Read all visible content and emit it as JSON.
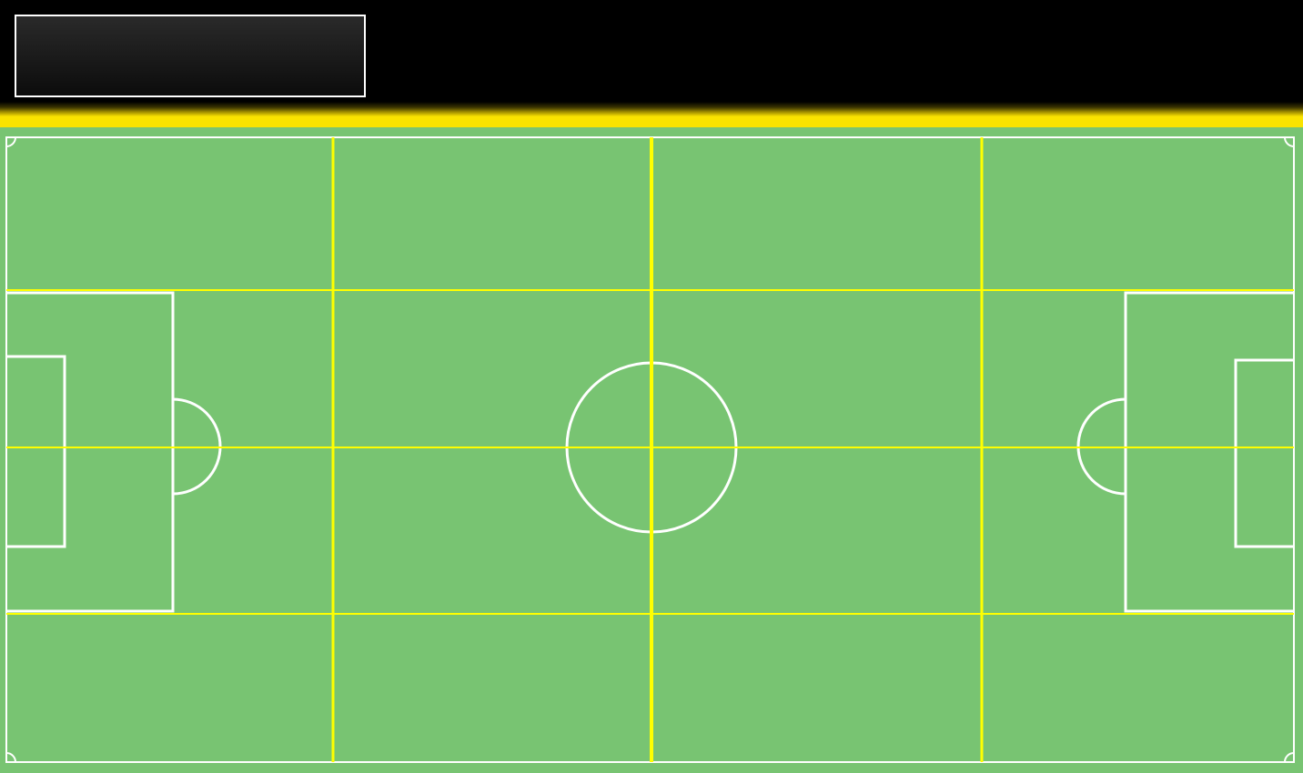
{
  "header": {
    "title": ""
  },
  "pitch": {
    "colors": {
      "grass": "#78c472",
      "line": "#ffffff",
      "grid": "#ffff00",
      "accent": "#f9e300",
      "header_bg": "#000000"
    },
    "grid": {
      "columns": 4,
      "rows": 3
    }
  }
}
